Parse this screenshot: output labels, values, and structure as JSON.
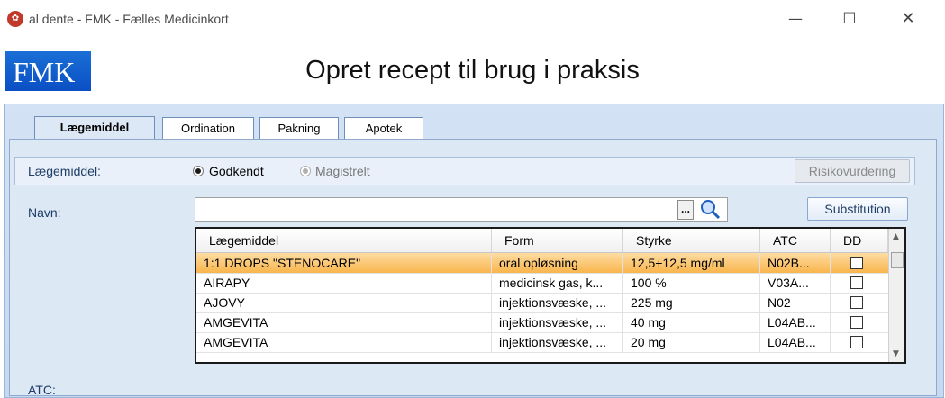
{
  "window": {
    "title": "al dente - FMK - Fælles Medicinkort",
    "minimize": "—",
    "maximize": "☐",
    "close": "✕"
  },
  "logo": "FMK",
  "page_title": "Opret recept til brug i praksis",
  "tabs": [
    {
      "label": "Lægemiddel",
      "active": true
    },
    {
      "label": "Ordination",
      "active": false
    },
    {
      "label": "Pakning",
      "active": false
    },
    {
      "label": "Apotek",
      "active": false
    }
  ],
  "form": {
    "laegemiddel_label": "Lægemiddel:",
    "radio_godkendt": "Godkendt",
    "radio_magistrelt": "Magistrelt",
    "risiko_button": "Risikovurdering",
    "navn_label": "Navn:",
    "navn_value": "",
    "ellipsis_button": "...",
    "substitution_button": "Substitution",
    "atc_label": "ATC:"
  },
  "grid": {
    "columns": [
      "Lægemiddel",
      "Form",
      "Styrke",
      "ATC",
      "DD"
    ],
    "rows": [
      {
        "name": "1:1 DROPS \"STENOCARE\"",
        "form": "oral opløsning",
        "styrke": "12,5+12,5 mg/ml",
        "atc": "N02B...",
        "selected": true
      },
      {
        "name": "AIRAPY",
        "form": "medicinsk gas, k...",
        "styrke": "100 %",
        "atc": "V03A...",
        "selected": false
      },
      {
        "name": "AJOVY",
        "form": "injektionsvæske, ...",
        "styrke": "225 mg",
        "atc": "N02",
        "selected": false
      },
      {
        "name": "AMGEVITA",
        "form": "injektionsvæske, ...",
        "styrke": "40 mg",
        "atc": "L04AB...",
        "selected": false
      },
      {
        "name": "AMGEVITA",
        "form": "injektionsvæske, ...",
        "styrke": "20 mg",
        "atc": "L04AB...",
        "selected": false
      }
    ]
  }
}
